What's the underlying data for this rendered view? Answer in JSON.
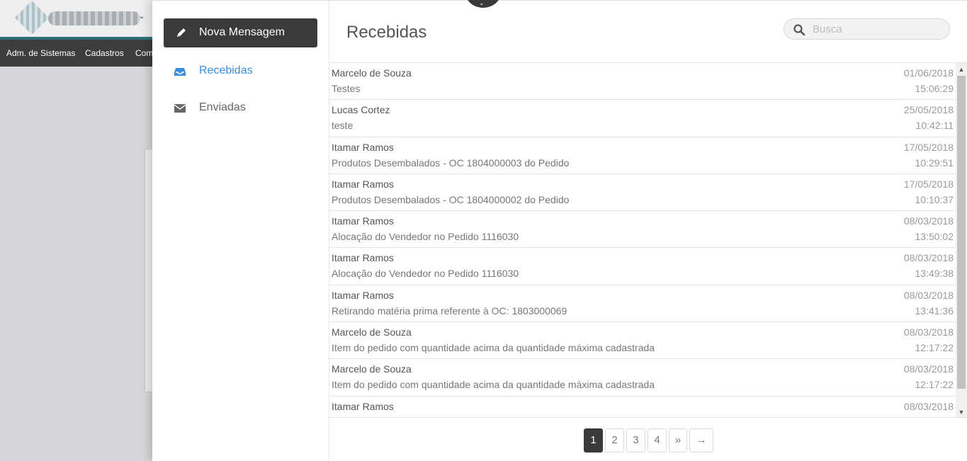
{
  "background_app": {
    "nav": [
      "Adm. de Sistemas",
      "Cadastros",
      "Com"
    ]
  },
  "menu": {
    "new_message": "Nova Mensagem",
    "inbox": "Recebidas",
    "sent": "Enviadas"
  },
  "main": {
    "title": "Recebidas",
    "search_placeholder": "Busca"
  },
  "messages": [
    {
      "from": "Marcelo de Souza",
      "subject": "Testes",
      "date": "01/06/2018",
      "time": "15:06:29"
    },
    {
      "from": "Lucas Cortez",
      "subject": "teste",
      "date": "25/05/2018",
      "time": "10:42:11"
    },
    {
      "from": "Itamar Ramos",
      "subject": "Produtos Desembalados - OC 1804000003 do Pedido",
      "date": "17/05/2018",
      "time": "10:29:51"
    },
    {
      "from": "Itamar Ramos",
      "subject": "Produtos Desembalados - OC 1804000002 do Pedido",
      "date": "17/05/2018",
      "time": "10:10:37"
    },
    {
      "from": "Itamar Ramos",
      "subject": "Alocação do Vendedor no Pedido 1116030",
      "date": "08/03/2018",
      "time": "13:50:02"
    },
    {
      "from": "Itamar Ramos",
      "subject": "Alocação do Vendedor no Pedido 1116030",
      "date": "08/03/2018",
      "time": "13:49:38"
    },
    {
      "from": "Itamar Ramos",
      "subject": "Retirando matéria prima referente à OC: 1803000069",
      "date": "08/03/2018",
      "time": "13:41:36"
    },
    {
      "from": "Marcelo de Souza",
      "subject": "Item do pedido com quantidade acima da quantidade máxima cadastrada",
      "date": "08/03/2018",
      "time": "12:17:22"
    },
    {
      "from": "Marcelo de Souza",
      "subject": "Item do pedido com quantidade acima da quantidade máxima cadastrada",
      "date": "08/03/2018",
      "time": "12:17:22"
    },
    {
      "from": "Itamar Ramos",
      "subject": "",
      "date": "08/03/2018",
      "time": ""
    }
  ],
  "pagination": {
    "pages": [
      "1",
      "2",
      "3",
      "4",
      "»",
      "→"
    ],
    "current": "1"
  },
  "colors": {
    "accent": "#3a8ddb",
    "dark": "#3a3a3a"
  },
  "icons": {
    "new_message": "pencil-icon",
    "inbox": "inbox-tray-icon",
    "sent": "envelope-icon",
    "search": "search-icon"
  }
}
